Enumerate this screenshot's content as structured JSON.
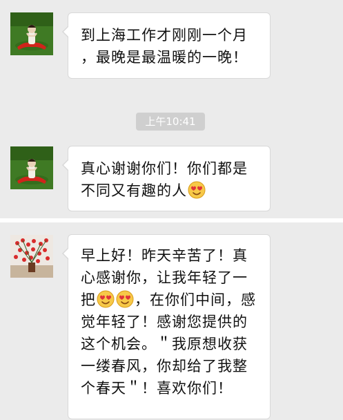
{
  "messages_top": [
    {
      "lines": [
        "到上海工作才刚刚一个月",
        "，最晚是最温暖的一晚！"
      ],
      "avatar_icon": "person-on-grass-avatar"
    },
    {
      "lines": [
        "真心谢谢你们！你们都是",
        "不同又有趣的人"
      ],
      "emoji_icon": "smiling-heart-eyes-emoji",
      "avatar_icon": "person-on-grass-avatar"
    }
  ],
  "timestamp": "上午10:41",
  "message_bottom": {
    "lines": [
      "早上好！昨天辛苦了！真",
      "心感谢你，让我年轻了一",
      "把",
      "，在你们中间，感",
      "觉年轻了！感谢您提供的",
      "这个机会。＂我原想收获",
      "一缕春风，你却给了我整",
      "个春天＂！喜欢你们！"
    ],
    "emoji_icon": "smiling-heart-eyes-emoji",
    "avatar_icon": "red-flowers-avatar"
  },
  "colors": {
    "chat_background": "#ebebeb",
    "divider": "#ffffff",
    "bubble": "#ffffff",
    "timestamp_pill": "#cfcfcf"
  }
}
